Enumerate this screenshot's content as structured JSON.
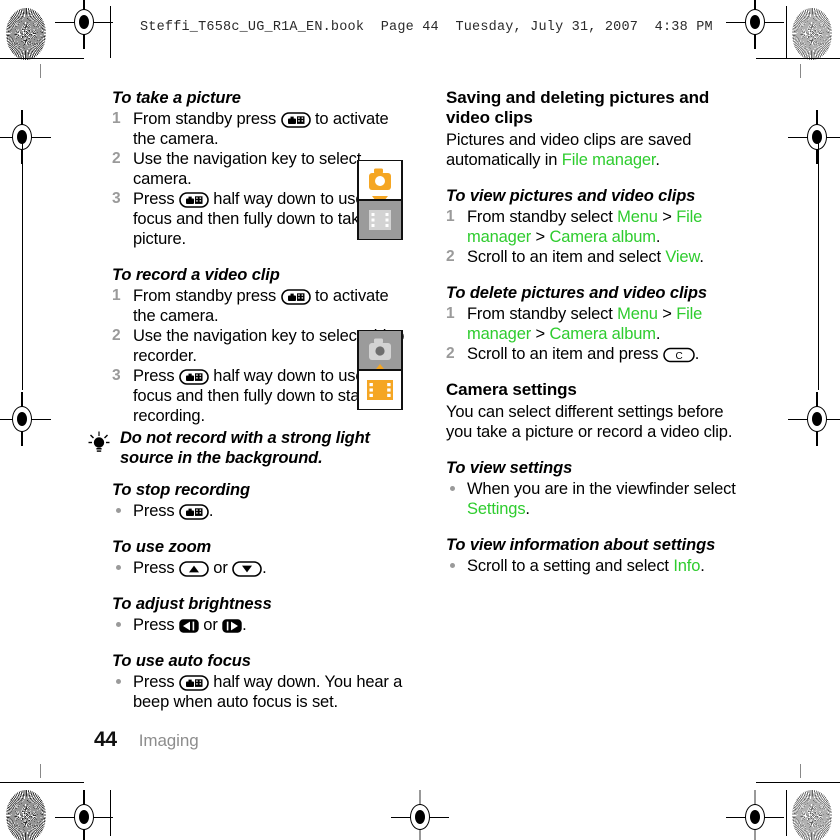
{
  "header": {
    "slug": "Steffi_T658c_UG_R1A_EN.book  Page 44  Tuesday, July 31, 2007  4:38 PM"
  },
  "colors": {
    "link_green": "#2ecc2e",
    "accent_orange": "#F5A623",
    "icon_grey": "#9B9B9B",
    "step_number_grey": "#9a9a9a",
    "chapter_grey": "#8d8d8d"
  },
  "left_column": {
    "section_take_picture": {
      "heading": "To take a picture",
      "steps": [
        {
          "num": "1",
          "pre": "From standby press ",
          "key": "camera-key",
          "post": " to activate the camera."
        },
        {
          "num": "2",
          "pre": "Use the navigation key to select camera.",
          "key": null,
          "post": ""
        },
        {
          "num": "3",
          "pre": "Press ",
          "key": "camera-key",
          "post": " half way down to use auto focus and then fully down to take a picture."
        }
      ]
    },
    "section_record_video": {
      "heading": "To record a video clip",
      "steps": [
        {
          "num": "1",
          "pre": "From standby press ",
          "key": "camera-key",
          "post": " to activate the camera."
        },
        {
          "num": "2",
          "pre": "Use the navigation key to select video recorder.",
          "key": null,
          "post": ""
        },
        {
          "num": "3",
          "pre": "Press ",
          "key": "camera-key",
          "post": " half way down to use auto focus and then fully down to start recording."
        }
      ]
    },
    "tip": {
      "icon": "lightbulb-icon",
      "text": "Do not record with a strong light source in the background."
    },
    "section_stop_recording": {
      "heading": "To stop recording",
      "bullets": [
        {
          "pre": "Press ",
          "key": "camera-key",
          "post": "."
        }
      ]
    },
    "section_use_zoom": {
      "heading": "To use zoom",
      "bullets": [
        {
          "pre": "Press ",
          "key": "up-key",
          "mid": " or ",
          "key2": "down-key",
          "post": "."
        }
      ]
    },
    "section_adjust_brightness": {
      "heading": "To adjust brightness",
      "bullets": [
        {
          "pre": "Press ",
          "key": "left-key",
          "mid": " or ",
          "key2": "right-key",
          "post": "."
        }
      ]
    },
    "section_auto_focus": {
      "heading": "To use auto focus",
      "bullets": [
        {
          "pre": "Press ",
          "key": "camera-key",
          "post": " half way down. You hear a beep when auto focus is set."
        }
      ]
    }
  },
  "right_column": {
    "section_saving_deleting": {
      "heading": "Saving and deleting pictures and video clips",
      "body_pre": "Pictures and video clips are saved automatically in ",
      "body_link": "File manager",
      "body_post": "."
    },
    "section_view_pictures": {
      "heading": "To view pictures and video clips",
      "steps": [
        {
          "num": "1",
          "parts": [
            {
              "t": "From standby select ",
              "green": false
            },
            {
              "t": "Menu",
              "green": true
            },
            {
              "t": " > ",
              "green": false
            },
            {
              "t": "File manager",
              "green": true
            },
            {
              "t": " > ",
              "green": false
            },
            {
              "t": "Camera album",
              "green": true
            },
            {
              "t": ".",
              "green": false
            }
          ]
        },
        {
          "num": "2",
          "parts": [
            {
              "t": "Scroll to an item and select ",
              "green": false
            },
            {
              "t": "View",
              "green": true
            },
            {
              "t": ".",
              "green": false
            }
          ]
        }
      ]
    },
    "section_delete_pictures": {
      "heading": "To delete pictures and video clips",
      "steps": [
        {
          "num": "1",
          "parts": [
            {
              "t": "From standby select ",
              "green": false
            },
            {
              "t": "Menu",
              "green": true
            },
            {
              "t": " > ",
              "green": false
            },
            {
              "t": "File manager",
              "green": true
            },
            {
              "t": " > ",
              "green": false
            },
            {
              "t": "Camera album",
              "green": true
            },
            {
              "t": ".",
              "green": false
            }
          ]
        }
      ],
      "step2_pre": "Scroll to an item and press ",
      "step2_num": "2",
      "step2_key": "c-key",
      "step2_post": "."
    },
    "section_camera_settings": {
      "heading": "Camera settings",
      "body": "You can select different settings before you take a picture or record a video clip."
    },
    "section_view_settings": {
      "heading": "To view settings",
      "bullet_pre": "When you are in the viewfinder select ",
      "bullet_link": "Settings",
      "bullet_post": "."
    },
    "section_view_info": {
      "heading": "To view information about settings",
      "bullet_pre": "Scroll to a setting and select ",
      "bullet_link": "Info",
      "bullet_post": "."
    }
  },
  "illustrations": {
    "camera_mode": {
      "name": "camera-mode-illustration",
      "top_icon": "camera-icon",
      "arrow": "arrow-down-icon",
      "bottom_icon": "film-strip-icon"
    },
    "video_mode": {
      "name": "video-mode-illustration",
      "top_icon": "camera-icon",
      "arrow": "arrow-up-icon",
      "bottom_icon": "film-strip-icon"
    }
  },
  "footer": {
    "page_number": "44",
    "chapter": "Imaging"
  },
  "key_labels": {
    "c_key": "C"
  }
}
